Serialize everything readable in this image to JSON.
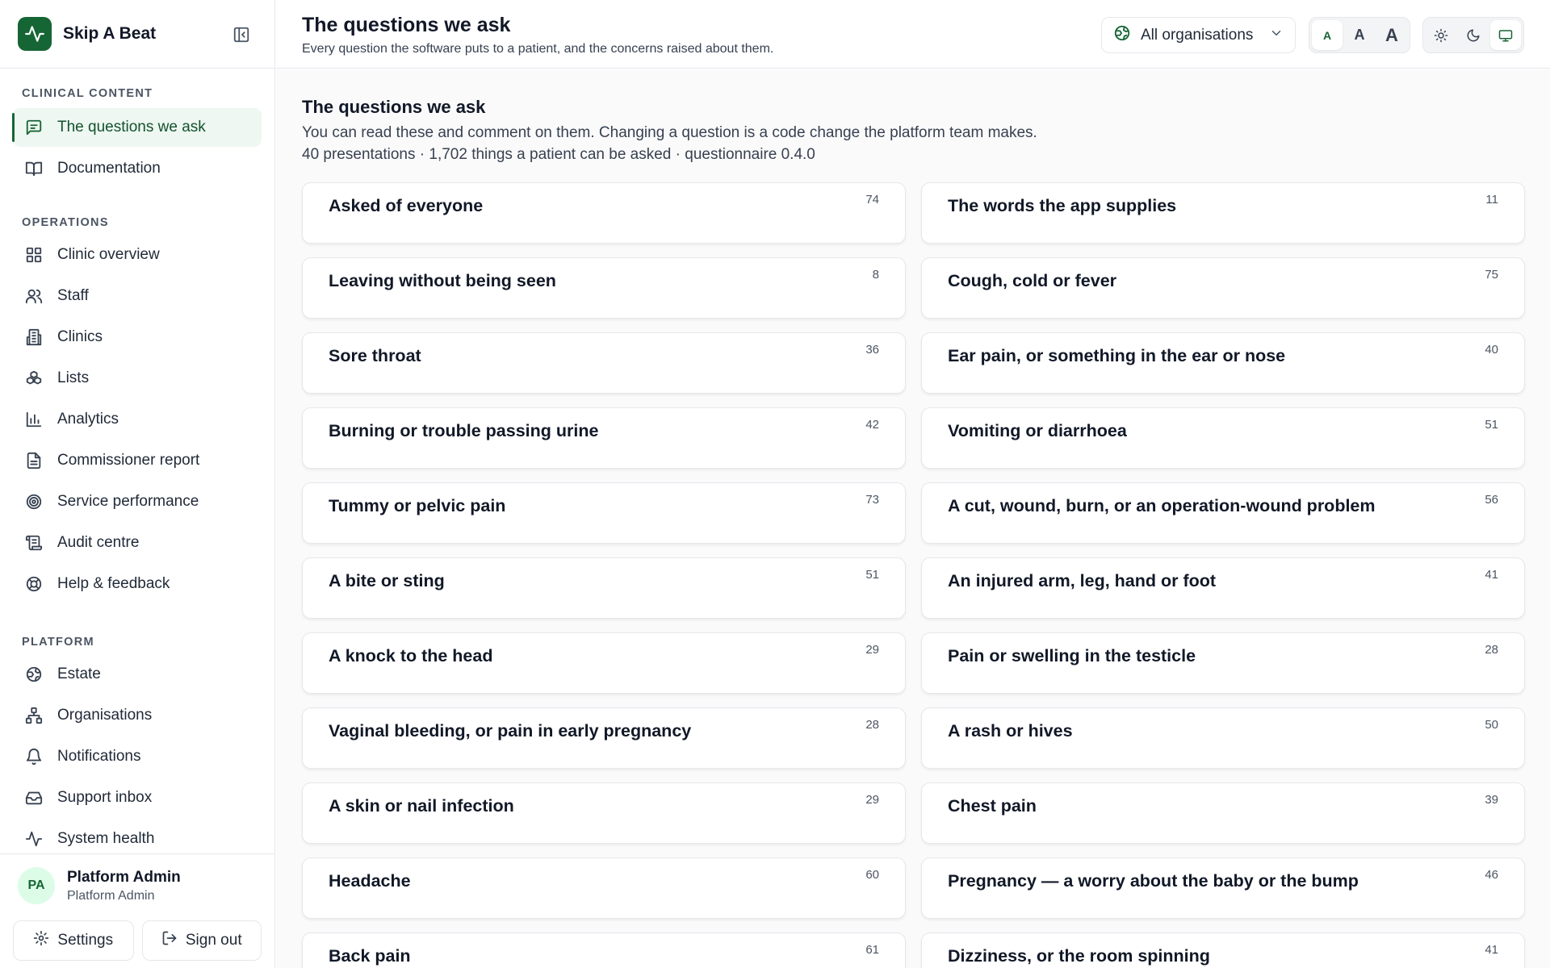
{
  "app": {
    "name": "Skip A Beat",
    "brand_color": "#166534",
    "logo_icon": "heartbeat-icon",
    "collapse_icon": "sidebar-collapse-icon"
  },
  "sidebar": {
    "sections": [
      {
        "label": "CLINICAL CONTENT",
        "items": [
          {
            "label": "The questions we ask",
            "icon": "message-square-icon",
            "active": true
          },
          {
            "label": "Documentation",
            "icon": "book-open-icon"
          }
        ]
      },
      {
        "label": "OPERATIONS",
        "items": [
          {
            "label": "Clinic overview",
            "icon": "grid-icon"
          },
          {
            "label": "Staff",
            "icon": "users-icon"
          },
          {
            "label": "Clinics",
            "icon": "building-icon"
          },
          {
            "label": "Lists",
            "icon": "boxes-icon"
          },
          {
            "label": "Analytics",
            "icon": "bar-chart-icon"
          },
          {
            "label": "Commissioner report",
            "icon": "file-text-icon"
          },
          {
            "label": "Service performance",
            "icon": "target-icon"
          },
          {
            "label": "Audit centre",
            "icon": "scroll-icon"
          },
          {
            "label": "Help & feedback",
            "icon": "life-buoy-icon"
          }
        ]
      },
      {
        "label": "PLATFORM",
        "items": [
          {
            "label": "Estate",
            "icon": "globe-icon"
          },
          {
            "label": "Organisations",
            "icon": "network-icon"
          },
          {
            "label": "Notifications",
            "icon": "bell-icon"
          },
          {
            "label": "Support inbox",
            "icon": "inbox-icon"
          },
          {
            "label": "System health",
            "icon": "activity-icon"
          }
        ]
      }
    ],
    "user": {
      "initials": "PA",
      "name": "Platform Admin",
      "role": "Platform Admin"
    },
    "settings_label": "Settings",
    "signout_label": "Sign out"
  },
  "topbar": {
    "title": "The questions we ask",
    "subtitle": "Every question the software puts to a patient, and the concerns raised about them.",
    "org_select": {
      "value": "All organisations",
      "icon": "globe-icon"
    },
    "text_size": {
      "options": [
        "A",
        "A",
        "A"
      ],
      "selected": 0
    },
    "theme": {
      "options": [
        "sun-icon",
        "moon-icon",
        "monitor-icon"
      ],
      "selected": 2
    }
  },
  "main": {
    "title": "The questions we ask",
    "description": "You can read these and comment on them. Changing a question is a code change the platform team makes.",
    "stats": "40 presentations · 1,702 things a patient can be asked · questionnaire 0.4.0",
    "cards": [
      {
        "title": "Asked of everyone",
        "count": "74"
      },
      {
        "title": "The words the app supplies",
        "count": "11"
      },
      {
        "title": "Leaving without being seen",
        "count": "8"
      },
      {
        "title": "Cough, cold or fever",
        "count": "75"
      },
      {
        "title": "Sore throat",
        "count": "36"
      },
      {
        "title": "Ear pain, or something in the ear or nose",
        "count": "40"
      },
      {
        "title": "Burning or trouble passing urine",
        "count": "42"
      },
      {
        "title": "Vomiting or diarrhoea",
        "count": "51"
      },
      {
        "title": "Tummy or pelvic pain",
        "count": "73"
      },
      {
        "title": "A cut, wound, burn, or an operation-wound problem",
        "count": "56"
      },
      {
        "title": "A bite or sting",
        "count": "51"
      },
      {
        "title": "An injured arm, leg, hand or foot",
        "count": "41"
      },
      {
        "title": "A knock to the head",
        "count": "29"
      },
      {
        "title": "Pain or swelling in the testicle",
        "count": "28"
      },
      {
        "title": "Vaginal bleeding, or pain in early pregnancy",
        "count": "28"
      },
      {
        "title": "A rash or hives",
        "count": "50"
      },
      {
        "title": "A skin or nail infection",
        "count": "29"
      },
      {
        "title": "Chest pain",
        "count": "39"
      },
      {
        "title": "Headache",
        "count": "60"
      },
      {
        "title": "Pregnancy — a worry about the baby or the bump",
        "count": "46"
      },
      {
        "title": "Back pain",
        "count": "61"
      },
      {
        "title": "Dizziness, or the room spinning",
        "count": "41"
      }
    ]
  }
}
